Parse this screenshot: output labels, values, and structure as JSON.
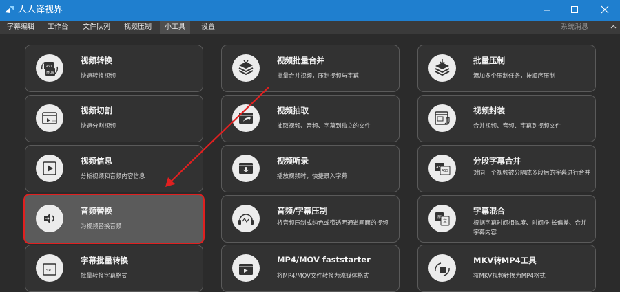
{
  "window": {
    "title": "人人译视界",
    "accent": "#1f7fcf"
  },
  "menu": {
    "tabs": [
      {
        "label": "字幕编辑"
      },
      {
        "label": "工作台"
      },
      {
        "label": "文件队列"
      },
      {
        "label": "视频压制"
      },
      {
        "label": "小工具",
        "active": true
      },
      {
        "label": "设置"
      }
    ],
    "system_message": "系统消息"
  },
  "tools": [
    {
      "title": "视频转换",
      "desc": "快速转换视频",
      "icon": "video-convert-icon"
    },
    {
      "title": "视频批量合并",
      "desc": "批量合并视频，压制视频与字幕",
      "icon": "batch-merge-icon"
    },
    {
      "title": "批量压制",
      "desc": "添加多个压制任务，按顺序压制",
      "icon": "batch-compress-icon"
    },
    {
      "title": "视频切割",
      "desc": "快速分割视频",
      "icon": "video-cut-icon"
    },
    {
      "title": "视频抽取",
      "desc": "抽取视频、音频、字幕到独立的文件",
      "icon": "video-extract-icon"
    },
    {
      "title": "视频封装",
      "desc": "合并视频、音频、字幕到视频文件",
      "icon": "video-package-icon"
    },
    {
      "title": "视频信息",
      "desc": "分析视频和音频内容信息",
      "icon": "video-info-icon"
    },
    {
      "title": "视频听录",
      "desc": "播放视频时，快捷录入字幕",
      "icon": "video-transcribe-icon"
    },
    {
      "title": "分段字幕合并",
      "desc": "对同一个视频被分隔成多段后的字幕进行合并",
      "icon": "subtitle-merge-icon"
    },
    {
      "title": "音频替换",
      "desc": "为视频替换音频",
      "icon": "audio-replace-icon",
      "selected": true
    },
    {
      "title": "音频/字幕压制",
      "desc": "将音频压制成纯色或带透明通道画面的视频",
      "icon": "audio-subtitle-compress-icon"
    },
    {
      "title": "字幕混合",
      "desc": "根据字幕时间相似度、时间/时长偏差、合并字幕内容",
      "icon": "subtitle-mix-icon"
    },
    {
      "title": "字幕批量转换",
      "desc": "批量转换字幕格式",
      "icon": "subtitle-batch-convert-icon"
    },
    {
      "title": "MP4/MOV faststarter",
      "desc": "将MP4/MOV文件转换为流媒体格式",
      "icon": "faststarter-icon"
    },
    {
      "title": "MKV转MP4工具",
      "desc": "将MKV视频转换为MP4格式",
      "icon": "mkv-to-mp4-icon"
    }
  ],
  "colors": {
    "annotation": "#e02020",
    "background": "#2b2b2b"
  }
}
